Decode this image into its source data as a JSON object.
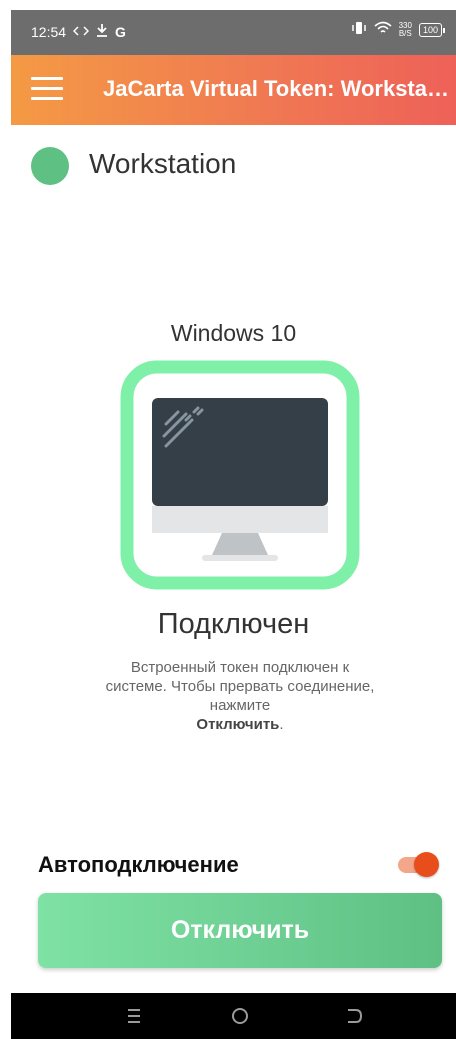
{
  "status_bar": {
    "time": "12:54",
    "left_icons": [
      "code-arrows-icon",
      "download-icon",
      "google-g-icon"
    ],
    "google_letter": "G",
    "net_speed_value": "330",
    "net_speed_unit": "B/S",
    "battery": "100",
    "right_icons": [
      "vibrate-icon",
      "wifi-icon",
      "battery-icon"
    ]
  },
  "app_bar": {
    "menu_icon": "hamburger-menu-icon",
    "title": "JaCarta Virtual Token: Workstation",
    "gradient": [
      "#f49a44",
      "#ee6158"
    ]
  },
  "workstation": {
    "name": "Workstation",
    "status_color": "#5fc084"
  },
  "main": {
    "os": "Windows 10",
    "computer_icon": "desktop-monitor-icon",
    "status": "Подключен",
    "description_text": "Встроенный токен подключен к системе. Чтобы прервать соединение, нажмите",
    "description_action": "Отключить",
    "description_end": "."
  },
  "auto_connect": {
    "label": "Автоподключение",
    "enabled": true,
    "accent": "#e84e1b"
  },
  "disconnect_button": {
    "label": "Отключить",
    "color": "#5fc084"
  },
  "nav_bar": {
    "icons": [
      "menu-nav-icon",
      "home-circle-icon",
      "back-arrow-icon"
    ]
  }
}
